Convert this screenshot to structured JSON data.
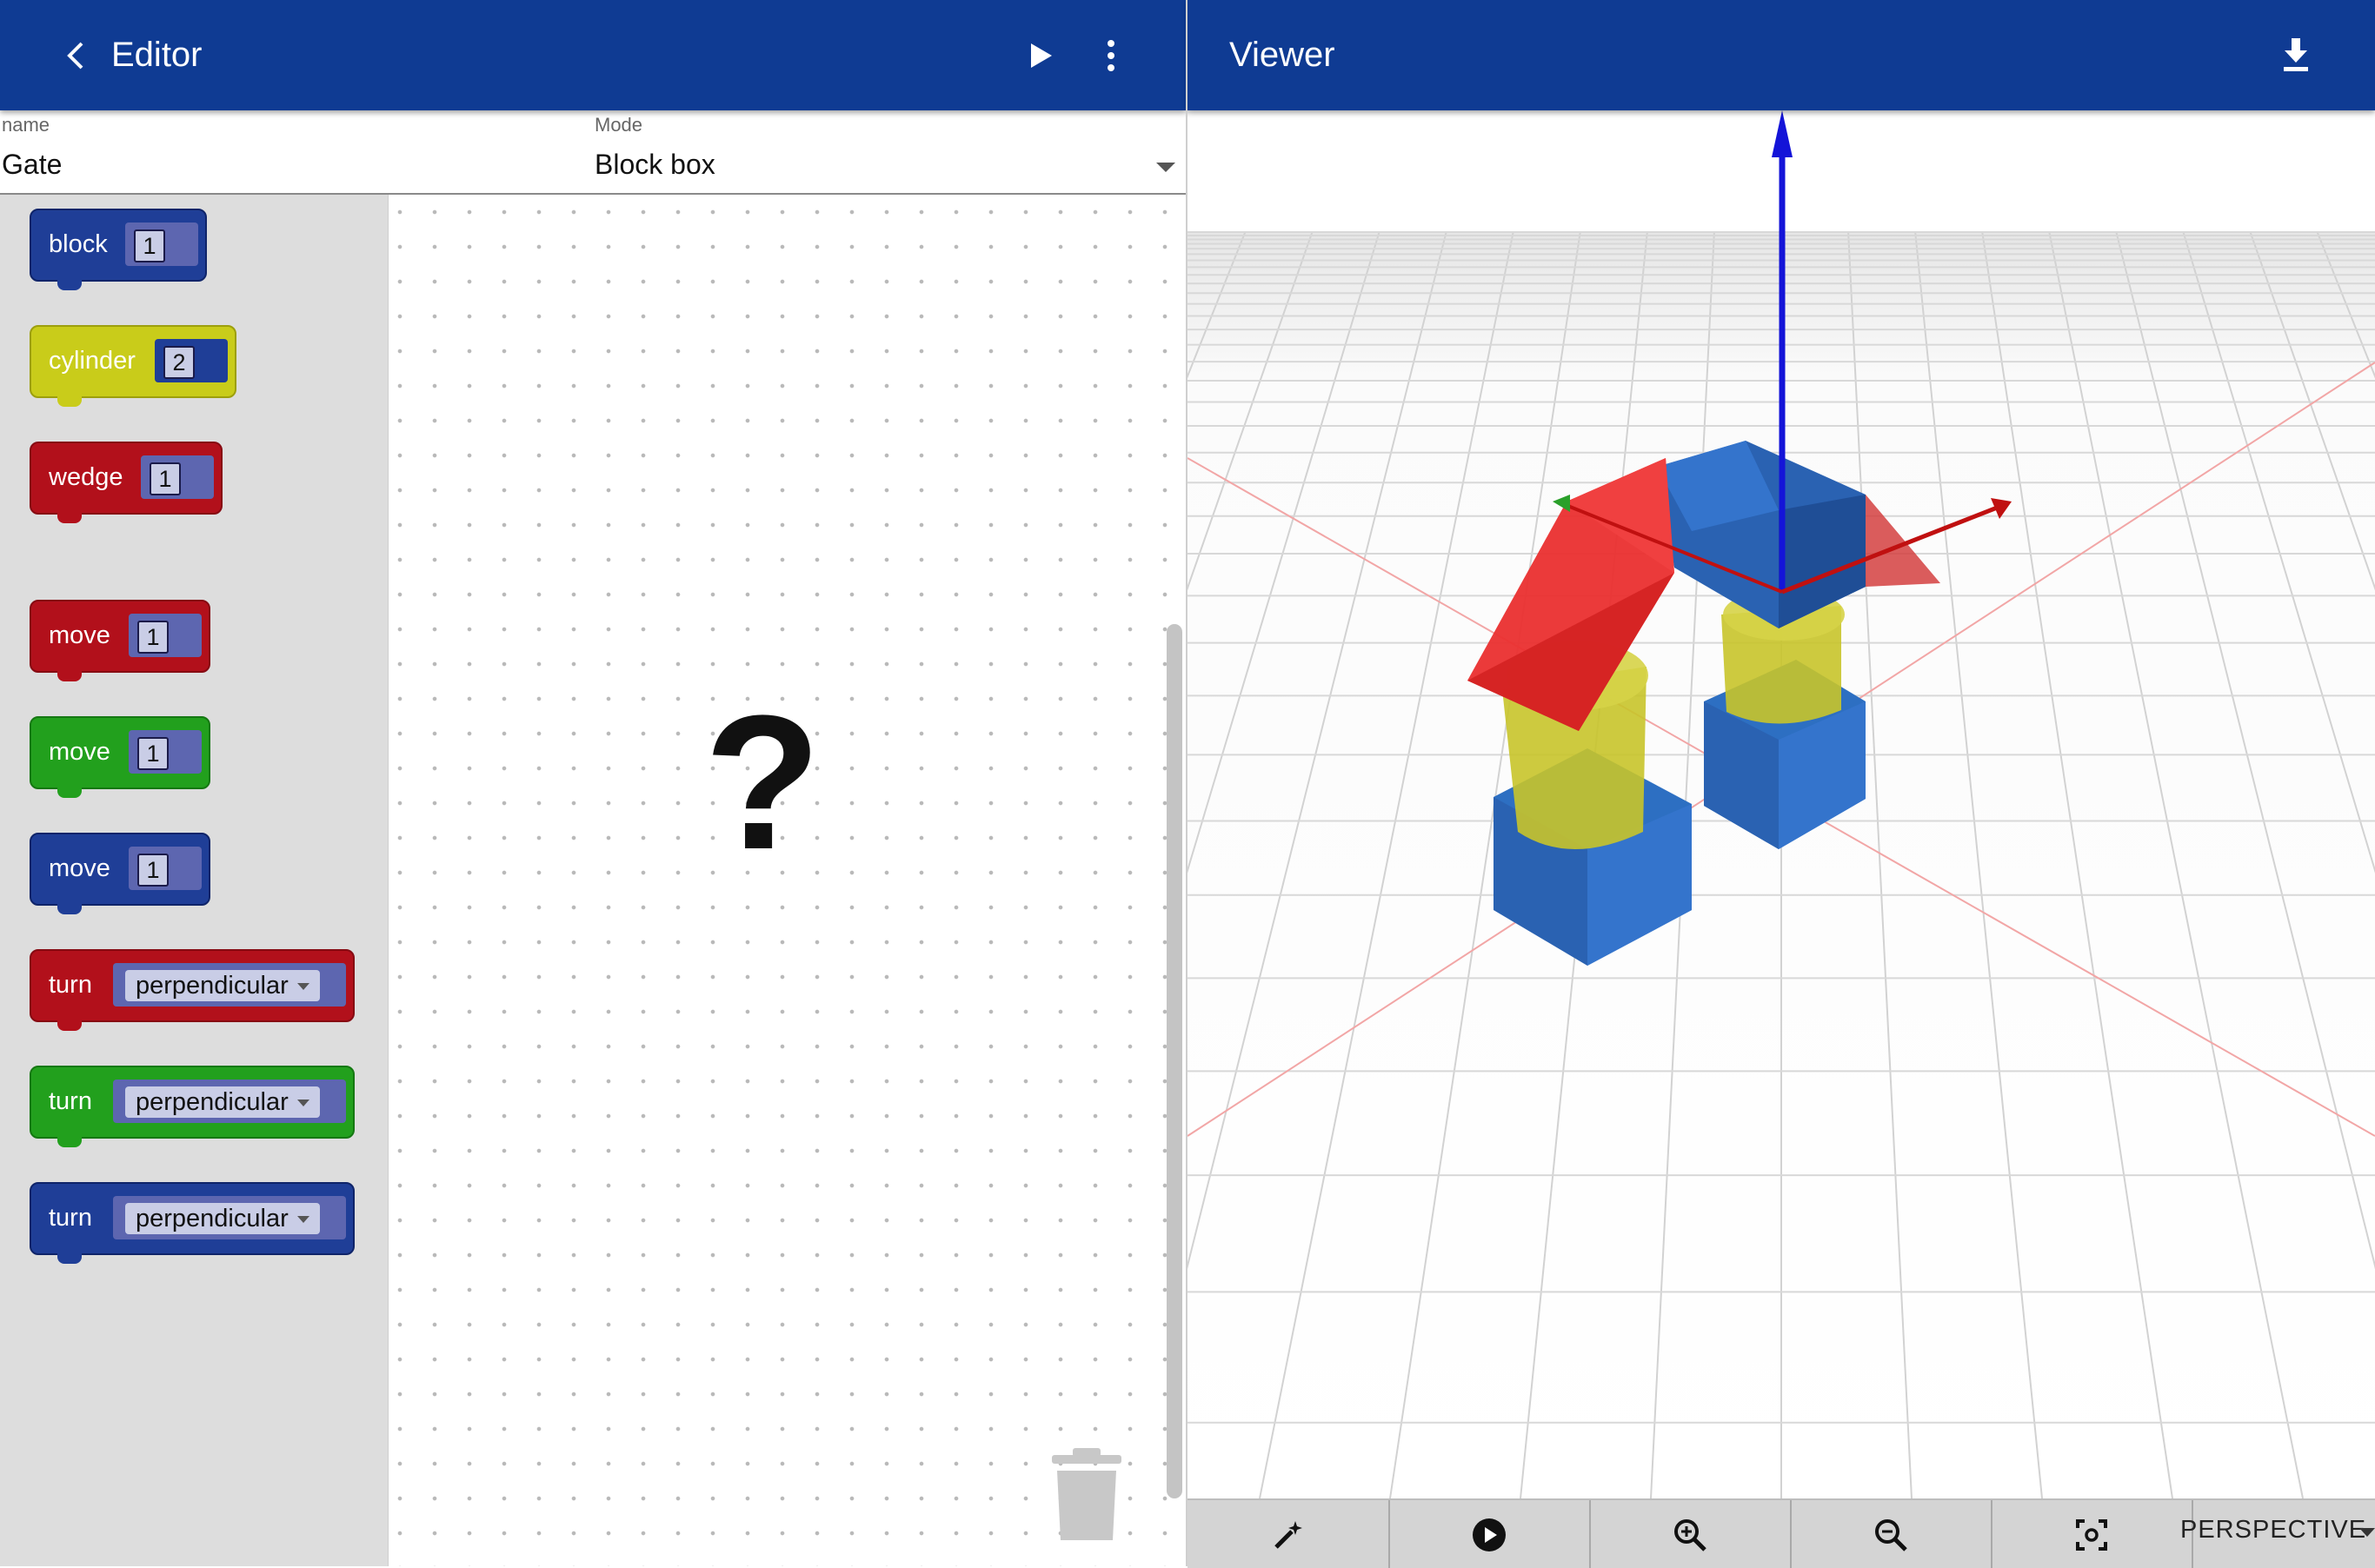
{
  "editor": {
    "title": "Editor",
    "icons": {
      "back": "chevron-left-icon",
      "run": "play-icon",
      "menu": "more-vert-icon"
    }
  },
  "viewer": {
    "title": "Viewer",
    "icons": {
      "download": "download-icon"
    }
  },
  "form": {
    "name_label": "name",
    "name_value": "Gate",
    "mode_label": "Mode",
    "mode_value": "Block box"
  },
  "workspace": {
    "placeholder": "?"
  },
  "toolbox": {
    "blocks": [
      {
        "label": "block",
        "color": "#1f3e97",
        "value": "1"
      },
      {
        "label": "cylinder",
        "color": "#c9cc1a",
        "value": "2"
      },
      {
        "label": "wedge",
        "color": "#b2101b",
        "value": "1"
      },
      {
        "label": "move",
        "color": "#b2101b",
        "value": "1"
      },
      {
        "label": "move",
        "color": "#22a01d",
        "value": "1"
      },
      {
        "label": "move",
        "color": "#1f3e97",
        "value": "1"
      },
      {
        "label": "turn",
        "color": "#b2101b",
        "value": "perpendicular"
      },
      {
        "label": "turn",
        "color": "#22a01d",
        "value": "perpendicular"
      },
      {
        "label": "turn",
        "color": "#1f3e97",
        "value": "perpendicular"
      }
    ]
  },
  "viewer_toolbar": {
    "buttons": [
      "magic-wand-icon",
      "play-circle-icon",
      "zoom-in-icon",
      "zoom-out-icon",
      "focus-icon"
    ],
    "camera_mode": "PERSPECTIVE"
  }
}
